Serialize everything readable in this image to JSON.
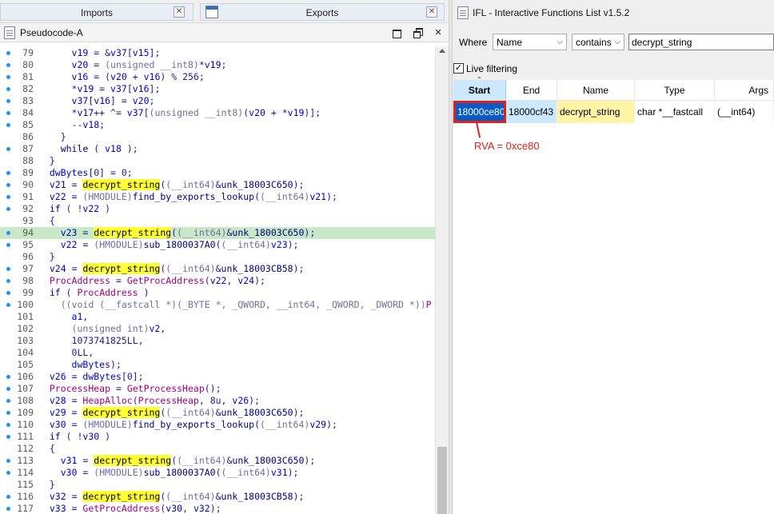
{
  "top_tabs": {
    "imports_label": "Imports",
    "exports_label": "Exports",
    "close_glyph": "✕"
  },
  "pseudocode": {
    "title": "Pseudocode-A",
    "lines": [
      {
        "n": "79",
        "dot": true,
        "hl": false,
        "html": "      <span class=\"v\">v19</span> = &amp;<span class=\"v\">v37</span>[<span class=\"v\">v15</span>];"
      },
      {
        "n": "80",
        "dot": true,
        "hl": false,
        "html": "      <span class=\"v\">v20</span> = <span class=\"g\">(unsigned __int8)</span>*<span class=\"v\">v19</span>;"
      },
      {
        "n": "81",
        "dot": true,
        "hl": false,
        "html": "      <span class=\"v\">v16</span> = (<span class=\"v\">v20</span> + <span class=\"v\">v16</span>) % 256;"
      },
      {
        "n": "82",
        "dot": true,
        "hl": false,
        "html": "      *<span class=\"v\">v19</span> = <span class=\"v\">v37</span>[<span class=\"v\">v16</span>];"
      },
      {
        "n": "83",
        "dot": true,
        "hl": false,
        "html": "      <span class=\"v\">v37</span>[<span class=\"v\">v16</span>] = <span class=\"v\">v20</span>;"
      },
      {
        "n": "84",
        "dot": true,
        "hl": false,
        "html": "      *<span class=\"v\">v17</span>++ ^= <span class=\"v\">v37</span>[<span class=\"g\">(unsigned __int8)</span>(<span class=\"v\">v20</span> + *<span class=\"v\">v19</span>)];"
      },
      {
        "n": "85",
        "dot": true,
        "hl": false,
        "html": "      --<span class=\"v\">v18</span>;"
      },
      {
        "n": "86",
        "dot": false,
        "hl": false,
        "html": "    }"
      },
      {
        "n": "87",
        "dot": true,
        "hl": false,
        "html": "    <span class=\"k\">while</span> ( <span class=\"v\">v18</span> );"
      },
      {
        "n": "88",
        "dot": false,
        "hl": false,
        "html": "  }"
      },
      {
        "n": "89",
        "dot": true,
        "hl": false,
        "html": "  <span class=\"v\">dwBytes</span>[0] = 0;"
      },
      {
        "n": "90",
        "dot": true,
        "hl": false,
        "html": "  <span class=\"v\">v21</span> = <span class=\"ylw\">decrypt_string</span>(<span class=\"g\">(__int64)</span>&amp;<span class=\"f\">unk_18003C650</span>);"
      },
      {
        "n": "91",
        "dot": true,
        "hl": false,
        "html": "  <span class=\"v\">v22</span> = <span class=\"g\">(HMODULE)</span><span class=\"f\">find_by_exports_lookup</span>(<span class=\"g\">(__int64)</span><span class=\"v\">v21</span>);"
      },
      {
        "n": "92",
        "dot": true,
        "hl": false,
        "html": "  <span class=\"k\">if</span> ( !<span class=\"v\">v22</span> )"
      },
      {
        "n": "93",
        "dot": false,
        "hl": false,
        "html": "  {"
      },
      {
        "n": "94",
        "dot": true,
        "hl": true,
        "html": "    <span class=\"v\">v23</span> = <span class=\"ylw\">decrypt_string</span>(<span class=\"g\">(__int64)</span>&amp;<span class=\"f\">unk_18003C650</span>);"
      },
      {
        "n": "95",
        "dot": true,
        "hl": false,
        "html": "    <span class=\"v\">v22</span> = <span class=\"g\">(HMODULE)</span><span class=\"f\">sub_1800037A0</span>(<span class=\"g\">(__int64)</span><span class=\"v\">v23</span>);"
      },
      {
        "n": "96",
        "dot": false,
        "hl": false,
        "html": "  }"
      },
      {
        "n": "97",
        "dot": true,
        "hl": false,
        "html": "  <span class=\"v\">v24</span> = <span class=\"ylw\">decrypt_string</span>(<span class=\"g\">(__int64)</span>&amp;<span class=\"f\">unk_18003CB58</span>);"
      },
      {
        "n": "98",
        "dot": true,
        "hl": false,
        "html": "  <span class=\"api\">ProcAddress</span> = <span class=\"api\">GetProcAddress</span>(<span class=\"v\">v22</span>, <span class=\"v\">v24</span>);"
      },
      {
        "n": "99",
        "dot": true,
        "hl": false,
        "html": "  <span class=\"k\">if</span> ( <span class=\"api\">ProcAddress</span> )"
      },
      {
        "n": "100",
        "dot": true,
        "hl": false,
        "html": "    <span class=\"g\">((void (__fastcall *)(_BYTE *, _QWORD, __int64, _QWORD, _DWORD *))</span><span class=\"api\">P</span>"
      },
      {
        "n": "101",
        "dot": false,
        "hl": false,
        "html": "      <span class=\"v\">a1</span>,"
      },
      {
        "n": "102",
        "dot": false,
        "hl": false,
        "html": "      <span class=\"g\">(unsigned int)</span><span class=\"v\">v2</span>,"
      },
      {
        "n": "103",
        "dot": false,
        "hl": false,
        "html": "      1073741825LL,"
      },
      {
        "n": "104",
        "dot": false,
        "hl": false,
        "html": "      0LL,"
      },
      {
        "n": "105",
        "dot": false,
        "hl": false,
        "html": "      <span class=\"v\">dwBytes</span>);"
      },
      {
        "n": "106",
        "dot": true,
        "hl": false,
        "html": "  <span class=\"v\">v26</span> = <span class=\"v\">dwBytes</span>[0];"
      },
      {
        "n": "107",
        "dot": true,
        "hl": false,
        "html": "  <span class=\"api\">ProcessHeap</span> = <span class=\"api\">GetProcessHeap</span>();"
      },
      {
        "n": "108",
        "dot": true,
        "hl": false,
        "html": "  <span class=\"v\">v28</span> = <span class=\"api\">HeapAlloc</span>(<span class=\"api\">ProcessHeap</span>, 8u, <span class=\"v\">v26</span>);"
      },
      {
        "n": "109",
        "dot": true,
        "hl": false,
        "html": "  <span class=\"v\">v29</span> = <span class=\"ylw\">decrypt_string</span>(<span class=\"g\">(__int64)</span>&amp;<span class=\"f\">unk_18003C650</span>);"
      },
      {
        "n": "110",
        "dot": true,
        "hl": false,
        "html": "  <span class=\"v\">v30</span> = <span class=\"g\">(HMODULE)</span><span class=\"f\">find_by_exports_lookup</span>(<span class=\"g\">(__int64)</span><span class=\"v\">v29</span>);"
      },
      {
        "n": "111",
        "dot": true,
        "hl": false,
        "html": "  <span class=\"k\">if</span> ( !<span class=\"v\">v30</span> )"
      },
      {
        "n": "112",
        "dot": false,
        "hl": false,
        "html": "  {"
      },
      {
        "n": "113",
        "dot": true,
        "hl": false,
        "html": "    <span class=\"v\">v31</span> = <span class=\"ylw\">decrypt_string</span>(<span class=\"g\">(__int64)</span>&amp;<span class=\"f\">unk_18003C650</span>);"
      },
      {
        "n": "114",
        "dot": true,
        "hl": false,
        "html": "    <span class=\"v\">v30</span> = <span class=\"g\">(HMODULE)</span><span class=\"f\">sub_1800037A0</span>(<span class=\"g\">(__int64)</span><span class=\"v\">v31</span>);"
      },
      {
        "n": "115",
        "dot": false,
        "hl": false,
        "html": "  }"
      },
      {
        "n": "116",
        "dot": true,
        "hl": false,
        "html": "  <span class=\"v\">v32</span> = <span class=\"ylw\">decrypt_string</span>(<span class=\"g\">(__int64)</span>&amp;<span class=\"f\">unk_18003CB58</span>);"
      },
      {
        "n": "117",
        "dot": true,
        "hl": false,
        "html": "  <span class=\"v\">v33</span> = <span class=\"api\">GetProcAddress</span>(<span class=\"v\">v30</span>, <span class=\"v\">v32</span>);"
      }
    ]
  },
  "ifl": {
    "title": "IFL - Interactive Functions List v1.5.2",
    "where_label": "Where",
    "field_value": "Name",
    "operator_value": "contains",
    "search_value": "decrypt_string",
    "live_filtering_label": "Live filtering",
    "live_filtering_checked": true,
    "columns": [
      "Start",
      "End",
      "Name",
      "Type",
      "Args"
    ],
    "sorted_column": "Start",
    "rows": [
      {
        "start": "18000ce80",
        "end": "18000cf43",
        "name": "decrypt_string",
        "type": "char *__fastcall",
        "args": "(__int64)"
      }
    ],
    "annotation": "RVA = 0xce80"
  },
  "colors": {
    "highlight_line": "#c8e8c8",
    "search_match": "#ffff33",
    "selection": "#0a5bc4",
    "annotation_red": "#e0201c"
  }
}
